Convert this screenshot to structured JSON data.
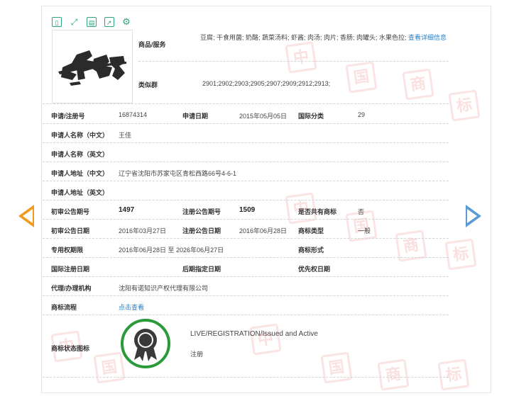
{
  "colors": {
    "accent_orange": "#f29a1f",
    "accent_blue": "#5a9bd5",
    "link": "#2a7fc4",
    "status_green": "#2a9a3a"
  },
  "toolbar_icons": [
    "copy-icon",
    "expand-icon",
    "save-icon",
    "export-icon",
    "settings-icon"
  ],
  "logo": {
    "text": "美克龙袋"
  },
  "goods": {
    "label": "商品/服务",
    "value": "豆腐; 干食用菌; 奶酪; 蔬菜汤料; 虾酱; 肉汤; 肉片; 香肠; 肉罐头; 水果色拉;",
    "more_link": "查看详细信息"
  },
  "similar_group": {
    "label": "类似群",
    "value": "2901;2902;2903;2905;2907;2909;2912;2913;"
  },
  "reg_no": {
    "label": "申请/注册号",
    "value": "16874314"
  },
  "apply_date": {
    "label": "申请日期",
    "value": "2015年05月05日"
  },
  "intl_class": {
    "label": "国际分类",
    "value": "29"
  },
  "applicant_cn": {
    "label": "申请人名称（中文）",
    "value": "王佳"
  },
  "applicant_en": {
    "label": "申请人名称（英文）",
    "value": ""
  },
  "address_cn": {
    "label": "申请人地址（中文）",
    "value": "辽宁省沈阳市苏家屯区青松西路66号4-6-1"
  },
  "address_en": {
    "label": "申请人地址（英文）",
    "value": ""
  },
  "prelim_issue": {
    "label": "初审公告期号",
    "value": "1497"
  },
  "reg_issue": {
    "label": "注册公告期号",
    "value": "1509"
  },
  "shared": {
    "label": "是否共有商标",
    "value": "否"
  },
  "prelim_date": {
    "label": "初审公告日期",
    "value": "2016年03月27日"
  },
  "reg_date": {
    "label": "注册公告日期",
    "value": "2016年06月28日"
  },
  "tm_type": {
    "label": "商标类型",
    "value": "一般"
  },
  "exclusive_period": {
    "label": "专用权期限",
    "value": "2016年06月28日 至 2026年06月27日"
  },
  "tm_form": {
    "label": "商标形式",
    "value": ""
  },
  "intl_reg_date": {
    "label": "国际注册日期",
    "value": ""
  },
  "later_date": {
    "label": "后期指定日期",
    "value": ""
  },
  "priority_date": {
    "label": "优先权日期",
    "value": ""
  },
  "agent": {
    "label": "代理/办理机构",
    "value": "沈阳有诺知识产权代理有限公司"
  },
  "process": {
    "label": "商标流程",
    "link": "点击查看"
  },
  "status": {
    "label": "商标状态图标",
    "en": "LIVE/REGISTRATION/Issued and Active",
    "cn": "注册"
  }
}
